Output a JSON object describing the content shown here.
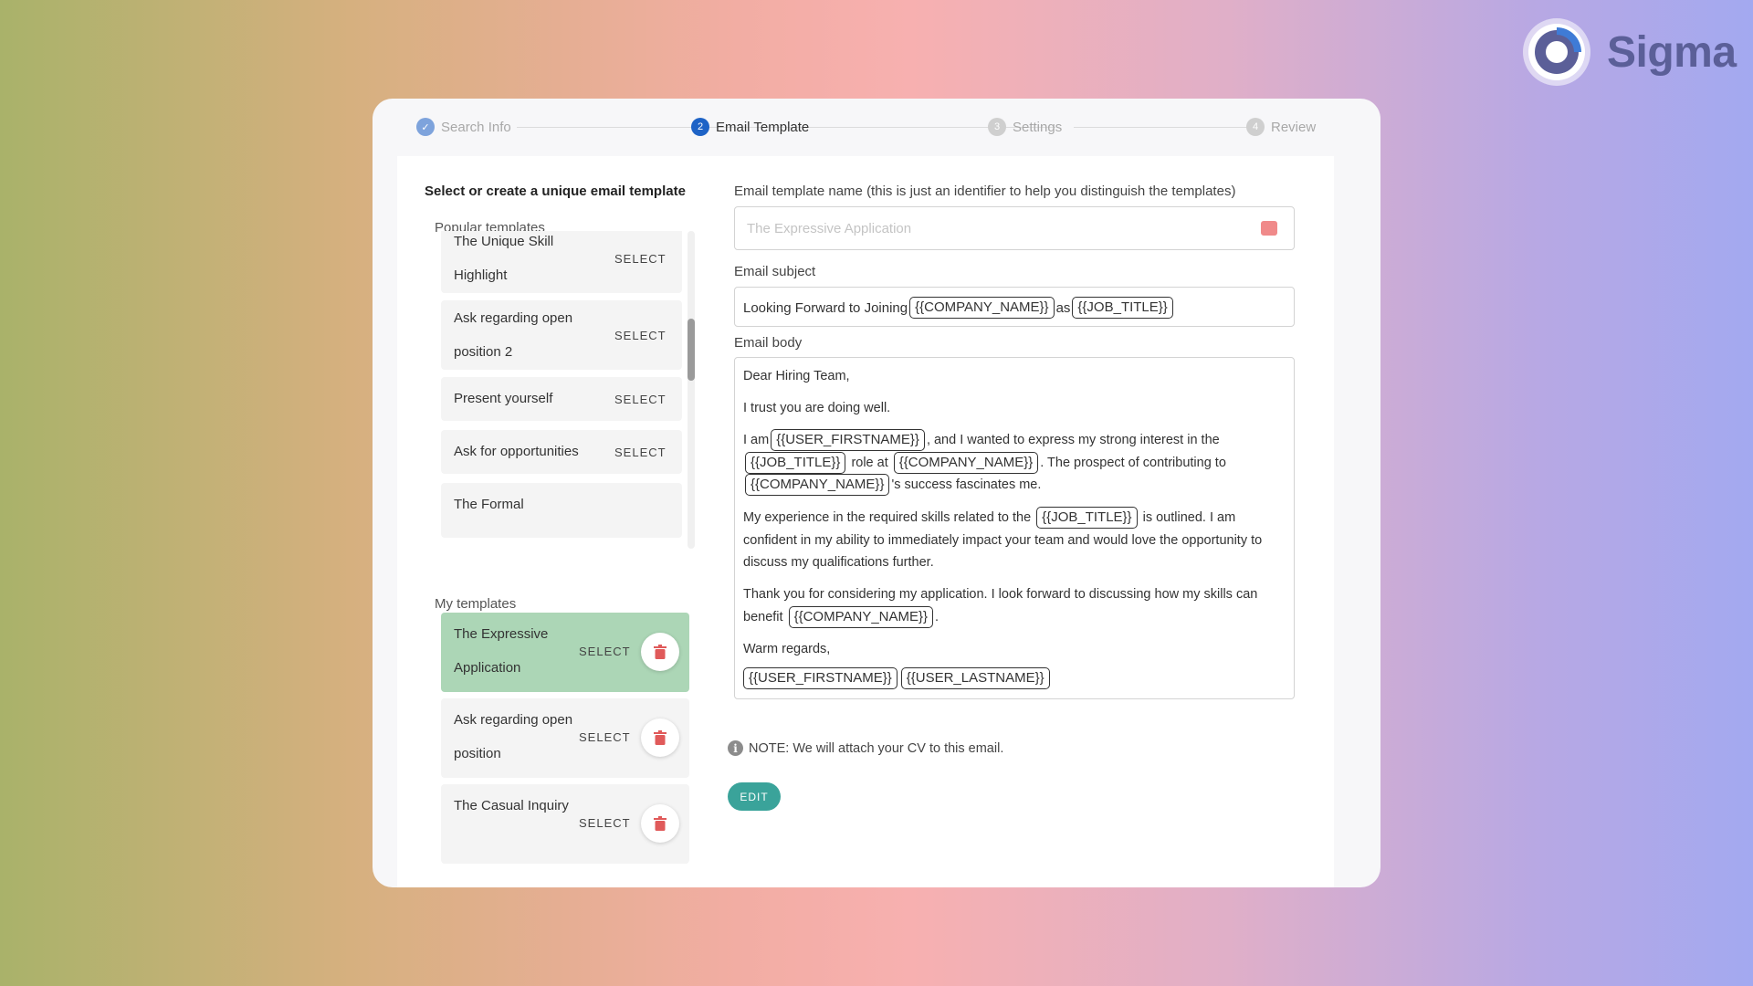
{
  "brand": {
    "name": "Sigma"
  },
  "stepper": {
    "steps": [
      {
        "num": "✓",
        "label": "Search Info",
        "state": "done"
      },
      {
        "num": "2",
        "label": "Email Template",
        "state": "active"
      },
      {
        "num": "3",
        "label": "Settings",
        "state": "pending"
      },
      {
        "num": "4",
        "label": "Review",
        "state": "pending"
      }
    ]
  },
  "left": {
    "title": "Select or create a unique email template",
    "popular_label": "Popular templates",
    "select_label": "SELECT",
    "popular": [
      {
        "name": "The Unique Skill Highlight"
      },
      {
        "name": "Ask regarding open position 2"
      },
      {
        "name": "Present yourself"
      },
      {
        "name": "Ask for opportunities"
      },
      {
        "name": "The Formal"
      }
    ],
    "my_label": "My templates",
    "mine": [
      {
        "name": "The Expressive Application",
        "selected": true
      },
      {
        "name": "Ask regarding open position",
        "selected": false
      },
      {
        "name": "The Casual Inquiry",
        "selected": false
      }
    ]
  },
  "right": {
    "name_label": "Email template name (this is just an identifier to help you distinguish the templates)",
    "name_placeholder": "The Expressive Application",
    "subject_label": "Email subject",
    "subject": {
      "prefix": "Looking Forward to Joining",
      "chip1": "{{COMPANY_NAME}}",
      "middle": "as",
      "chip2": "{{JOB_TITLE}}"
    },
    "body_label": "Email body",
    "body": {
      "greeting": "Dear Hiring Team,",
      "line2": "I trust you are doing well.",
      "p3_a": "I am",
      "p3_chip1": "{{USER_FIRSTNAME}}",
      "p3_b": ", and I wanted to express my strong interest in the",
      "p3_chip2": "{{JOB_TITLE}}",
      "p3_c": "role at",
      "p3_chip3": "{{COMPANY_NAME}}",
      "p3_d": ". The prospect of contributing to",
      "p3_chip4": "{{COMPANY_NAME}}",
      "p3_e": "'s success fascinates me.",
      "p4_a": "My experience in the required skills related to the",
      "p4_chip": "{{JOB_TITLE}}",
      "p4_b": "is outlined. I am confident in my ability to immediately impact your team and would love the opportunity to discuss my qualifications further.",
      "p5_a": "Thank you for considering my application. I look forward to discussing how my skills can benefit",
      "p5_chip": "{{COMPANY_NAME}}",
      "p5_b": ".",
      "closing": "Warm regards,",
      "sig1": "{{USER_FIRSTNAME}}",
      "sig2": "{{USER_LASTNAME}}"
    },
    "note": "NOTE: We will attach your CV to this email.",
    "edit_label": "EDIT"
  },
  "colors": {
    "active_step": "#1e63c6",
    "selected_template": "#acd6b6",
    "edit_button": "#3aa39a",
    "delete_icon": "#e05a5a"
  }
}
